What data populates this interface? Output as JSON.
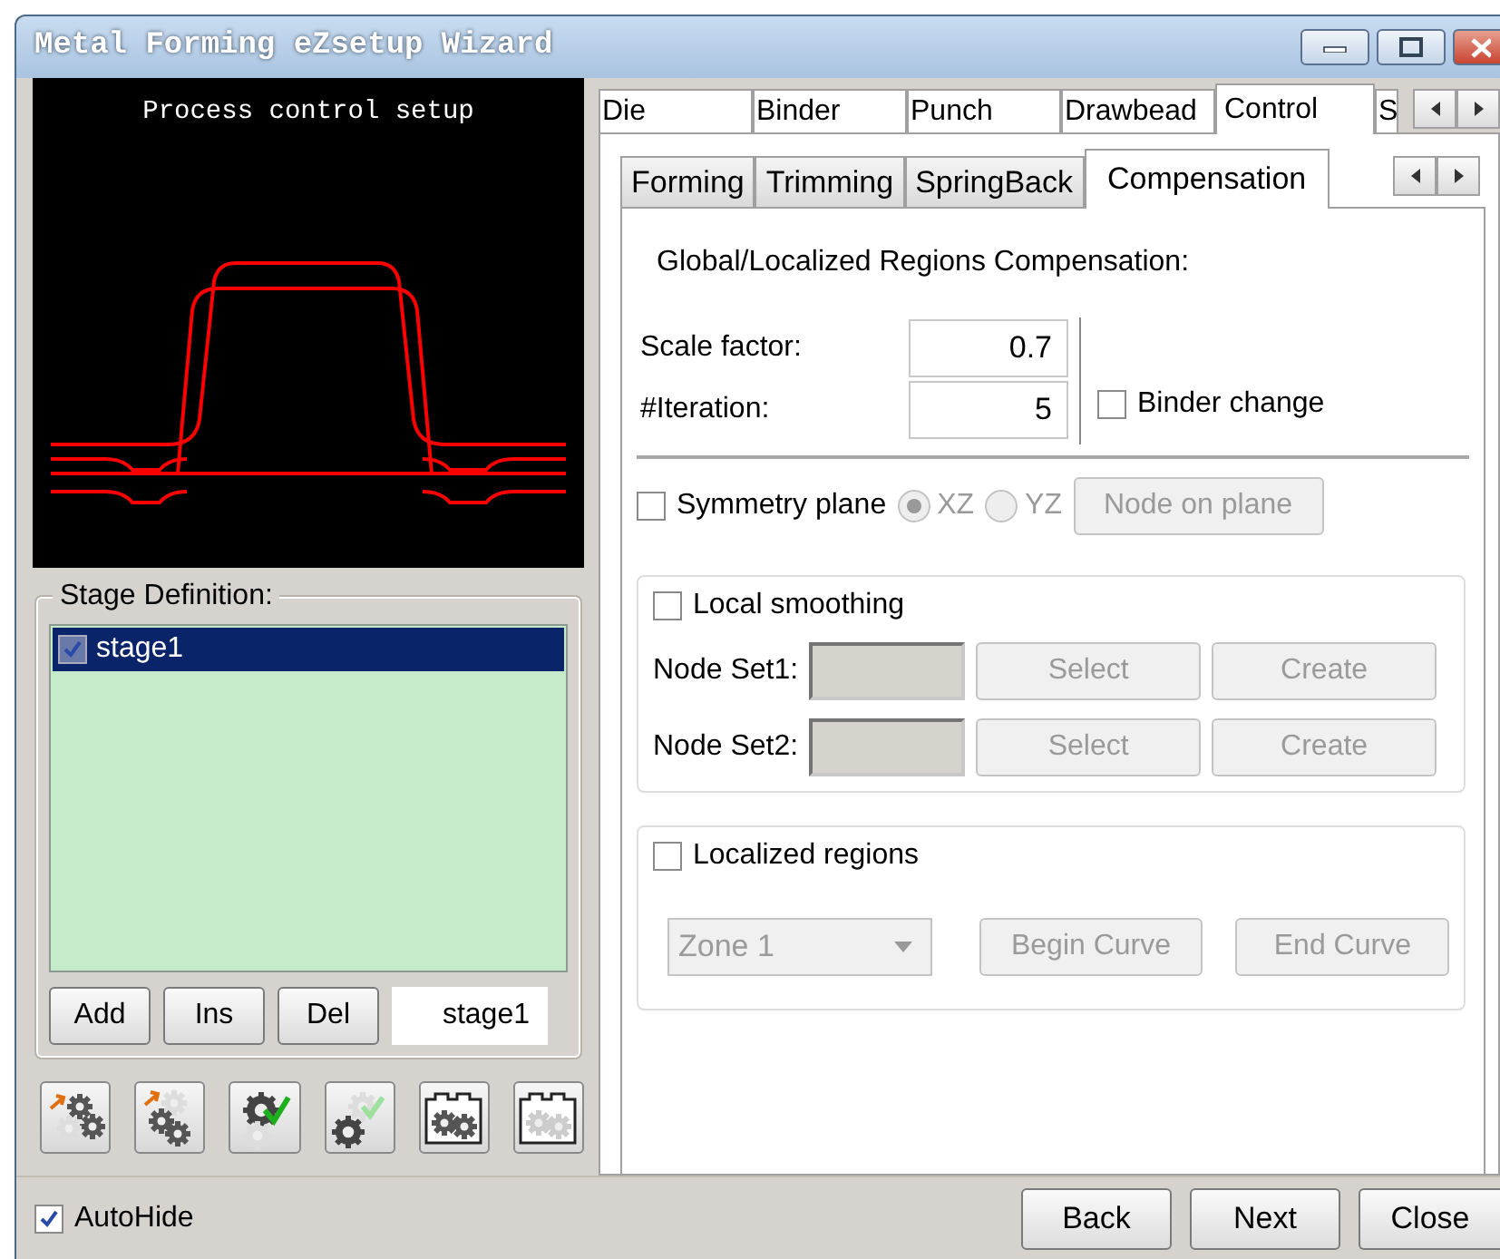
{
  "window": {
    "title": "Metal Forming eZsetup Wizard"
  },
  "preview": {
    "caption": "Process control setup"
  },
  "stage_definition": {
    "label": "Stage Definition:",
    "items": [
      {
        "label": "stage1",
        "checked": true,
        "selected": true
      }
    ],
    "buttons": [
      "Add",
      "Ins",
      "Del"
    ],
    "name_value": "stage1"
  },
  "autohide": {
    "label": "AutoHide",
    "checked": true
  },
  "outer_tabs": [
    {
      "label": "Die",
      "selected": false
    },
    {
      "label": "Binder",
      "selected": false
    },
    {
      "label": "Punch",
      "selected": false
    },
    {
      "label": "Drawbead",
      "selected": false
    },
    {
      "label": "Control",
      "selected": true
    },
    {
      "label": "S",
      "selected": false
    }
  ],
  "inner_tabs": [
    {
      "label": "Forming",
      "selected": false
    },
    {
      "label": "Trimming",
      "selected": false
    },
    {
      "label": "SpringBack",
      "selected": false
    },
    {
      "label": "Compensation",
      "selected": true
    }
  ],
  "compensation": {
    "heading": "Global/Localized Regions Compensation:",
    "fields": [
      {
        "label": "Scale factor:",
        "value": "0.7"
      },
      {
        "label": "#Iteration:",
        "value": "5"
      }
    ],
    "binder_change": {
      "label": "Binder change",
      "checked": false
    },
    "symmetry": {
      "label": "Symmetry plane",
      "checked": false,
      "options": [
        {
          "label": "XZ",
          "selected": true
        },
        {
          "label": "YZ",
          "selected": false
        }
      ],
      "button": {
        "label": "Node on plane",
        "disabled": true
      }
    },
    "local_smoothing": {
      "label": "Local smoothing",
      "checked": false,
      "rows": [
        {
          "label": "Node Set1:",
          "buttons": [
            {
              "label": "Select",
              "disabled": true
            },
            {
              "label": "Create",
              "disabled": true
            }
          ]
        },
        {
          "label": "Node Set2:",
          "buttons": [
            {
              "label": "Select",
              "disabled": true
            },
            {
              "label": "Create",
              "disabled": true
            }
          ]
        }
      ]
    },
    "localized_regions": {
      "label": "Localized regions",
      "checked": false,
      "zone": {
        "value": "Zone 1",
        "disabled": true
      },
      "buttons": [
        {
          "label": "Begin Curve",
          "disabled": true
        },
        {
          "label": "End Curve",
          "disabled": true
        }
      ]
    }
  },
  "footer_buttons": [
    "Back",
    "Next",
    "Close"
  ]
}
